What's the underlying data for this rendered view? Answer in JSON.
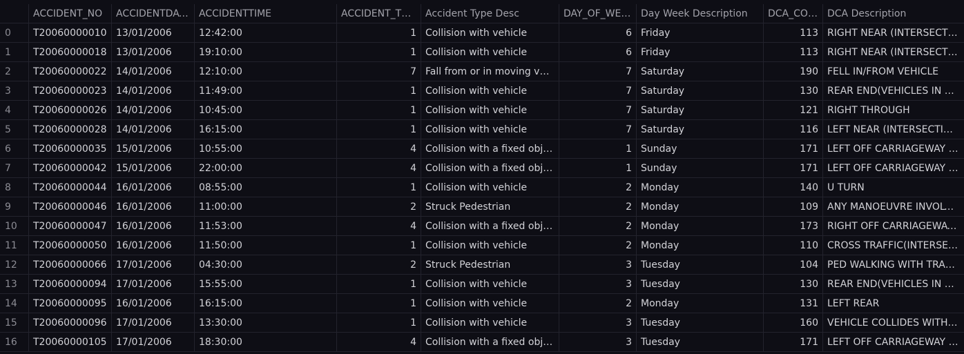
{
  "columns": [
    "",
    "ACCIDENT_NO",
    "ACCIDENTDATE",
    "ACCIDENTTIME",
    "ACCIDENT_TYPE",
    "Accident Type Desc",
    "DAY_OF_WEEK",
    "Day Week Description",
    "DCA_CODE",
    "DCA Description"
  ],
  "rows": [
    [
      "0",
      "T20060000010",
      "13/01/2006",
      "12:42:00",
      "1",
      "Collision with vehicle",
      "6",
      "Friday",
      "113",
      "RIGHT NEAR (INTERSECTIONS ONLY)"
    ],
    [
      "1",
      "T20060000018",
      "13/01/2006",
      "19:10:00",
      "1",
      "Collision with vehicle",
      "6",
      "Friday",
      "113",
      "RIGHT NEAR (INTERSECTIONS ONLY)"
    ],
    [
      "2",
      "T20060000022",
      "14/01/2006",
      "12:10:00",
      "7",
      "Fall from or in moving vehicle",
      "7",
      "Saturday",
      "190",
      "FELL IN/FROM VEHICLE"
    ],
    [
      "3",
      "T20060000023",
      "14/01/2006",
      "11:49:00",
      "1",
      "Collision with vehicle",
      "7",
      "Saturday",
      "130",
      "REAR END(VEHICLES IN SAME LANE)"
    ],
    [
      "4",
      "T20060000026",
      "14/01/2006",
      "10:45:00",
      "1",
      "Collision with vehicle",
      "7",
      "Saturday",
      "121",
      "RIGHT THROUGH"
    ],
    [
      "5",
      "T20060000028",
      "14/01/2006",
      "16:15:00",
      "1",
      "Collision with vehicle",
      "7",
      "Saturday",
      "116",
      "LEFT NEAR (INTERSECTIONS ONLY)"
    ],
    [
      "6",
      "T20060000035",
      "15/01/2006",
      "10:55:00",
      "4",
      "Collision with a fixed object",
      "1",
      "Sunday",
      "171",
      "LEFT OFF CARRIAGEWAY INTO OBJECT"
    ],
    [
      "7",
      "T20060000042",
      "15/01/2006",
      "22:00:00",
      "4",
      "Collision with a fixed object",
      "1",
      "Sunday",
      "171",
      "LEFT OFF CARRIAGEWAY INTO OBJECT"
    ],
    [
      "8",
      "T20060000044",
      "16/01/2006",
      "08:55:00",
      "1",
      "Collision with vehicle",
      "2",
      "Monday",
      "140",
      "U TURN"
    ],
    [
      "9",
      "T20060000046",
      "16/01/2006",
      "11:00:00",
      "2",
      "Struck Pedestrian",
      "2",
      "Monday",
      "109",
      "ANY MANOEUVRE INVOLVING PED"
    ],
    [
      "10",
      "T20060000047",
      "16/01/2006",
      "11:53:00",
      "4",
      "Collision with a fixed object",
      "2",
      "Monday",
      "173",
      "RIGHT OFF CARRIAGEWAY INTO OBJECT"
    ],
    [
      "11",
      "T20060000050",
      "16/01/2006",
      "11:50:00",
      "1",
      "Collision with vehicle",
      "2",
      "Monday",
      "110",
      "CROSS TRAFFIC(INTERSECTIONS ONLY)"
    ],
    [
      "12",
      "T20060000066",
      "17/01/2006",
      "04:30:00",
      "2",
      "Struck Pedestrian",
      "3",
      "Tuesday",
      "104",
      "PED WALKING WITH TRAFFIC"
    ],
    [
      "13",
      "T20060000094",
      "17/01/2006",
      "15:55:00",
      "1",
      "Collision with vehicle",
      "3",
      "Tuesday",
      "130",
      "REAR END(VEHICLES IN SAME LANE)"
    ],
    [
      "14",
      "T20060000095",
      "16/01/2006",
      "16:15:00",
      "1",
      "Collision with vehicle",
      "2",
      "Monday",
      "131",
      "LEFT REAR"
    ],
    [
      "15",
      "T20060000096",
      "17/01/2006",
      "13:30:00",
      "1",
      "Collision with vehicle",
      "3",
      "Tuesday",
      "160",
      "VEHICLE COLLIDES WITH VEHICLE PARKED"
    ],
    [
      "16",
      "T20060000105",
      "17/01/2006",
      "18:30:00",
      "4",
      "Collision with a fixed object",
      "3",
      "Tuesday",
      "171",
      "LEFT OFF CARRIAGEWAY INTO OBJECT"
    ]
  ]
}
